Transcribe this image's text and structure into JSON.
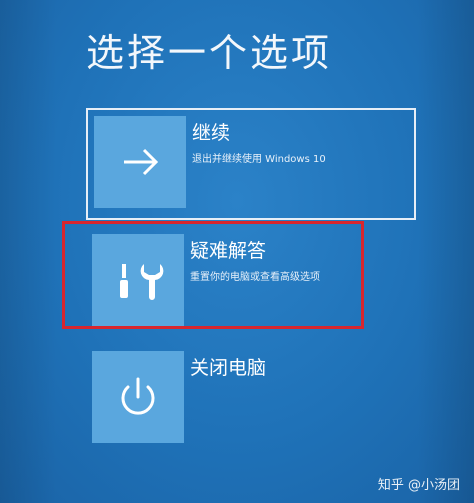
{
  "page": {
    "title": "选择一个选项"
  },
  "options": {
    "continue": {
      "label": "继续",
      "description": "退出并继续使用 Windows 10",
      "icon": "arrow-right-icon"
    },
    "troubleshoot": {
      "label": "疑难解答",
      "description": "重置你的电脑或查看高级选项",
      "icon": "tools-icon"
    },
    "shutdown": {
      "label": "关闭电脑",
      "icon": "power-icon"
    }
  },
  "annotation": {
    "highlight_color": "#d8262e"
  },
  "watermark": {
    "text": "知乎 @小汤团"
  },
  "colors": {
    "background": "#1f72b8",
    "tile": "#5aa7de",
    "text": "#ffffff"
  }
}
